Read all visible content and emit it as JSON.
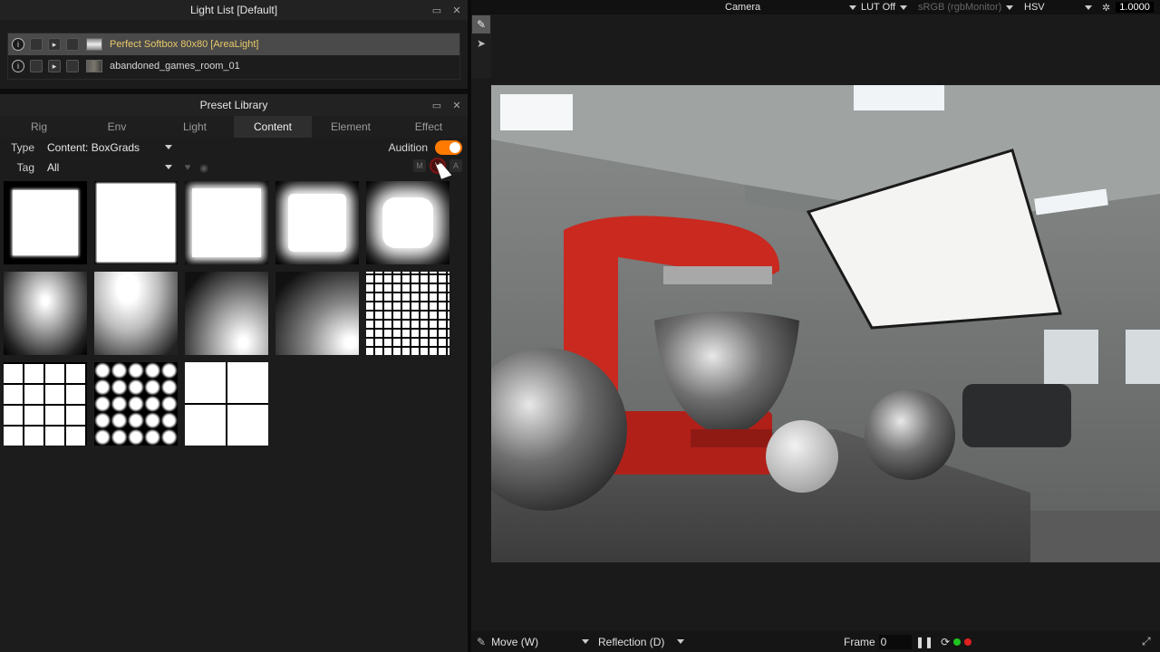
{
  "light_list": {
    "title": "Light List [Default]",
    "rows": [
      {
        "name": "Perfect Softbox 80x80 [AreaLight]",
        "selected": true,
        "thumb": "softbox-thumb"
      },
      {
        "name": "abandoned_games_room_01",
        "selected": false,
        "thumb": "environment-thumb"
      }
    ]
  },
  "preset_library": {
    "title": "Preset Library",
    "tabs": [
      "Rig",
      "Env",
      "Light",
      "Content",
      "Element",
      "Effect"
    ],
    "active_tab": "Content",
    "type_label": "Type",
    "type_value": "Content: BoxGrads",
    "tag_label": "Tag",
    "tag_value": "All",
    "audition_label": "Audition",
    "audition_on": true,
    "mva": [
      "M",
      "V",
      "A"
    ],
    "active_mva": "V"
  },
  "topbar": {
    "camera": "Camera",
    "lut": "LUT Off",
    "color_space": "sRGB (rgbMonitor)",
    "mode": "HSV",
    "exposure": "1.0000"
  },
  "bottombar": {
    "tool": "Move (W)",
    "mode": "Reflection (D)",
    "frame_label": "Frame",
    "frame_value": "0"
  },
  "colors": {
    "accent": "#ff7a00",
    "selected_text": "#e8c86a",
    "status_green": "#1fc31f",
    "status_red": "#e02020"
  }
}
